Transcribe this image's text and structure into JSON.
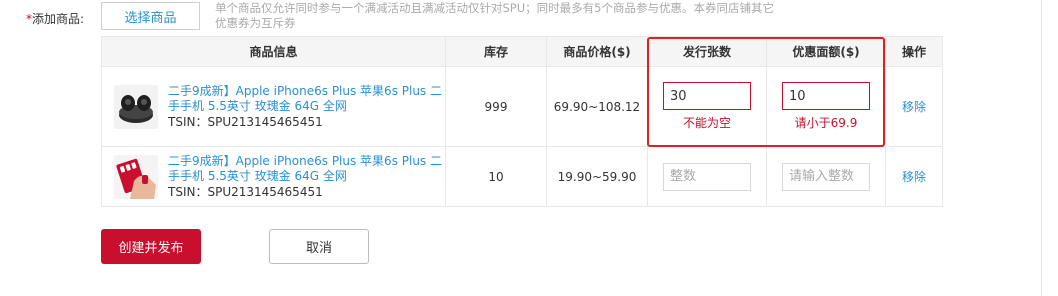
{
  "form": {
    "required_mark": "*",
    "label": "添加商品:",
    "select_button": "选择商品",
    "hint_line1": "单个商品仅允许同时参与一个满减活动且满减活动仅针对SPU；同时最多有5个商品参与优惠。本券同店铺其它",
    "hint_line2": "优惠券为互斥券"
  },
  "table": {
    "headers": [
      "商品信息",
      "库存",
      "商品价格($)",
      "发行张数",
      "优惠面额($)",
      "操作"
    ],
    "rows": [
      {
        "name": "二手9成新】Apple iPhone6s Plus 苹果6s Plus 二手手机 5.5英寸 玫瑰金 64G 全网",
        "tsin": "TSIN：SPU213145465451",
        "stock": "999",
        "price": "69.90~108.12",
        "issue_value": "30",
        "issue_placeholder": "整数",
        "issue_error": "不能为空",
        "discount_value": "10",
        "discount_placeholder": "请输入整数",
        "discount_error": "请小于69.9",
        "action": "移除",
        "thumb_icon": "earbuds-product-icon"
      },
      {
        "name": "二手9成新】Apple iPhone6s Plus 苹果6s Plus 二手手机 5.5英寸 玫瑰金 64G 全网",
        "tsin": "TSIN：SPU213145465451",
        "stock": "10",
        "price": "19.90~59.90",
        "issue_value": "",
        "issue_placeholder": "整数",
        "issue_error": "",
        "discount_value": "",
        "discount_placeholder": "请输入整数",
        "discount_error": "",
        "action": "移除",
        "thumb_icon": "nail-stickers-product-icon"
      }
    ]
  },
  "actions": {
    "create_publish": "创建并发布",
    "cancel": "取消"
  },
  "colors": {
    "primary": "#c8102e",
    "link": "#2a8fd4",
    "highlight_box": "#e02020"
  }
}
